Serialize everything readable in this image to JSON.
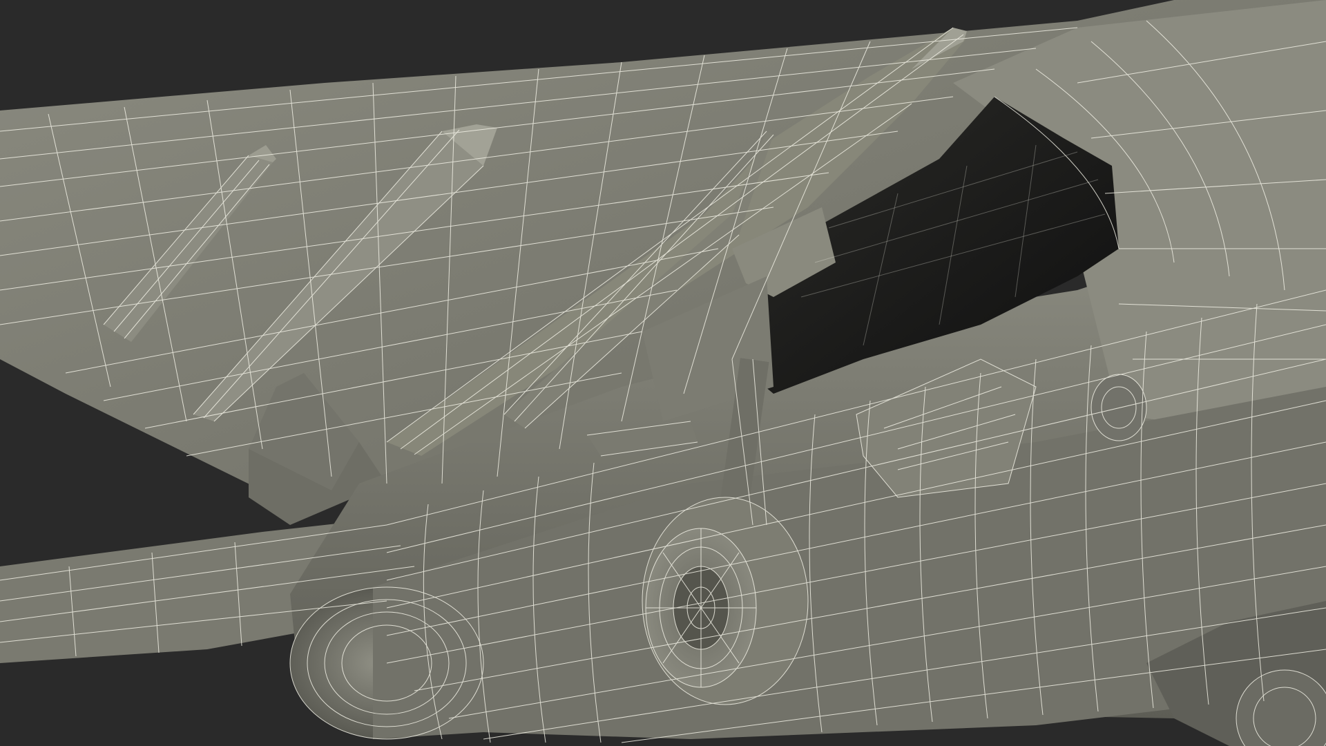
{
  "render": {
    "background_color": "#2a2a2a",
    "surface_color": "#7d7d72",
    "surface_light_color": "#9a9a8e",
    "surface_dark_color": "#55554d",
    "cavity_color": "#151515",
    "wire_color": "#f2f1e6"
  },
  "scene": {
    "subject": "aircraft-underside-wireframe",
    "parts": [
      "wing-left",
      "wing-root",
      "missile-pylon-left",
      "missile-left-outer",
      "missile-left-inner",
      "fuselage-main",
      "engine-intake-cavity",
      "intake-lip",
      "fuel-tank-underside",
      "landing-gear-strut",
      "landing-gear-wheel",
      "rear-gear-assembly",
      "small-fin",
      "wing-lower-trailing"
    ]
  }
}
